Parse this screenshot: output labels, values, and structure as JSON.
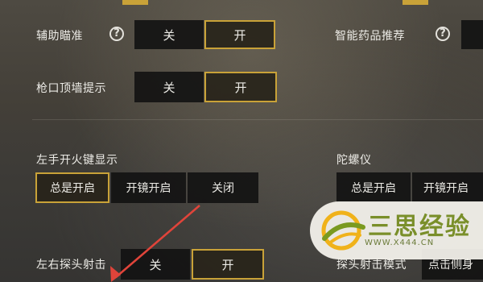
{
  "rows": {
    "aim_assist": {
      "label": "辅助瞄准",
      "off": "关",
      "on": "开"
    },
    "smart_meds": {
      "label": "智能药品推荐"
    },
    "muzzle_wall": {
      "label": "枪口顶墙提示",
      "off": "关",
      "on": "开"
    },
    "left_fire": {
      "label": "左手开火键显示",
      "options": [
        "总是开启",
        "开镜开启",
        "关闭"
      ]
    },
    "gyro": {
      "label": "陀螺仪",
      "options": [
        "总是开启",
        "开镜开启"
      ]
    },
    "peek_fire": {
      "label": "左右探头射击",
      "off": "关",
      "on": "开"
    },
    "peek_mode": {
      "label": "探头射击模式",
      "option": "点击侧身"
    }
  },
  "help_glyph": "?",
  "watermark": {
    "text": "三思经验",
    "url": "WWW.X444.CN"
  },
  "colors": {
    "accent": "#c9a238",
    "arrow": "#e0443a"
  }
}
